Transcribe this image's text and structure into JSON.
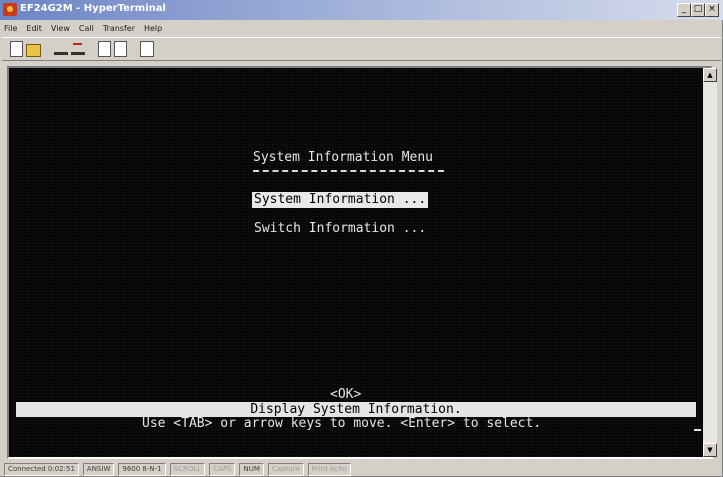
{
  "window": {
    "title": "EF24G2M - HyperTerminal",
    "controls": [
      "_",
      "□",
      "×"
    ]
  },
  "menubar": {
    "items": [
      "File",
      "Edit",
      "View",
      "Call",
      "Transfer",
      "Help"
    ]
  },
  "toolbar": {
    "icons": [
      "new-icon",
      "open-icon",
      "phone-icon",
      "hangup-icon",
      "send-icon",
      "receive-icon",
      "properties-icon"
    ]
  },
  "terminal": {
    "menu_title": "System Information Menu",
    "options": [
      "System Information ...",
      "Switch Information ..."
    ],
    "selected_option_index": 0,
    "ok_button": "<OK>",
    "status_line": "Display System Information.",
    "help_line": "Use <TAB> or arrow keys to move. <Enter> to select."
  },
  "scrollbar": {
    "up": "▲",
    "down": "▼"
  },
  "statusbar": {
    "connected": "Connected 0:02:51",
    "emulation": "ANSIW",
    "settings": "9600 8-N-1",
    "scroll": "SCROLL",
    "caps": "CAPS",
    "num": "NUM",
    "capture": "Capture",
    "echo": "Print echo"
  },
  "colors": {
    "terminal_bg": "#050505",
    "terminal_fg": "#e6e6e6",
    "highlight_bg": "#e8e8e8",
    "chrome": "#d4d0c8",
    "titlebar": "#6c85c5"
  }
}
